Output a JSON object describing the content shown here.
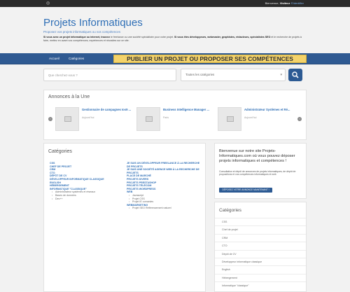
{
  "topbar": {
    "rss_icon": "rss-icon",
    "welcome_prefix": "Bienvenue, ",
    "welcome_user": "Visiteur",
    "welcome_link": "S'identifier"
  },
  "header": {
    "title": "Projets Informatiques",
    "subtitle": "Proposez vos projets informatiques ou vos compétences",
    "description_lead": "Si vous avez un projet informatique ou internet, trouvez",
    "description_body": " le freelance ou une société spécialisée pour votre projet. ",
    "description_bold2": "Si vous êtes développeurs, webmaster, graphistes, rédacteurs, spécialistes SEO",
    "description_tail": " et le recherche de projets à faire, mettez en avant vos compétences, expériences et réussites sur ce site."
  },
  "nav": {
    "home": "Accueil",
    "categories": "Catégories",
    "cta": "PUBLIER UN PROJET OU PROPOSER SES COMPÉTENCES"
  },
  "search": {
    "placeholder": "Que cherchez-vous ?",
    "category_selected": "Toutes les catégories",
    "button_icon": "search-icon"
  },
  "annonces": {
    "title": "Annonces à la Une",
    "items": [
      {
        "title": "Gestionnaire de campagnes Ios9 ...",
        "meta": "Aujourd'hui"
      },
      {
        "title": "Business Intelligence Manager ...",
        "meta": "Paris"
      },
      {
        "title": "Administrateur Systèmes et Ré...",
        "meta": "Aujourd'hui"
      }
    ]
  },
  "categories": {
    "title": "Catégories",
    "col1": [
      {
        "label": "CSS",
        "sub": false
      },
      {
        "label": "CHEF DE PROJET",
        "sub": false
      },
      {
        "label": "CRM",
        "sub": false
      },
      {
        "label": "CTO",
        "sub": false
      },
      {
        "label": "DÉPÔT DE CV",
        "sub": false
      },
      {
        "label": "DÉVELOPPEUR INFORMATIQUE CLASSIQUE",
        "sub": false
      },
      {
        "label": "ENGLISH",
        "sub": false
      },
      {
        "label": "HÉBERGEMENT",
        "sub": false
      },
      {
        "label": "INFORMATIQUE \"CLASSIQUE\"",
        "sub": false
      },
      {
        "label": "Administrateur systèmes et réseaux",
        "sub": true
      },
      {
        "label": "Bases de données",
        "sub": true
      },
      {
        "label": "Dev++",
        "sub": true
      }
    ],
    "col2": [
      {
        "label": "JE SUIS UN DÉVELOPPEUR FREELANCE À LA RECHERCHE DE PROJETS",
        "sub": false
      },
      {
        "label": "JE SUIS UNE SOCIÉTÉ AGENCE WEB À LA RECHERCHE DE PROJETS",
        "sub": false
      },
      {
        "label": "PLACE DE MARCHÉ",
        "sub": false
      },
      {
        "label": "PROJETS DIVERS",
        "sub": false
      },
      {
        "label": "PROJETS PRESTASHOP",
        "sub": false
      },
      {
        "label": "PROJETS TÉLÉCOM",
        "sub": false
      },
      {
        "label": "PROJETS WORDPRESS",
        "sub": false
      },
      {
        "label": "WEB",
        "sub": false
      },
      {
        "label": "Javascript",
        "sub": true
      },
      {
        "label": "Projet CSS",
        "sub": true
      },
      {
        "label": "Projet IE comanies",
        "sub": true
      },
      {
        "label": "WEBMARKETING",
        "sub": false
      },
      {
        "label": "Projet SEO Référencement naturel",
        "sub": true
      }
    ]
  },
  "welcome_box": {
    "title": "Bienvenue sur notre site Projets-Informatiques.com où vous pouvez déposer projets informatiques et compétences !",
    "text": "Consultation et dépôt de annonces de projets informatiques, de dépôt de propositions et vos compétences informatiques et web",
    "button": "DÉPOSEZ VOTRE ANNONCE MAINTENANT !"
  },
  "side_categories": {
    "title": "Catégories",
    "items": [
      "CSS",
      "Chef de projet",
      "CRM",
      "CTO",
      "Dépôt de CV",
      "Développeur informatique classique",
      "English",
      "Hébergement",
      "Informatique \"classique\""
    ]
  }
}
